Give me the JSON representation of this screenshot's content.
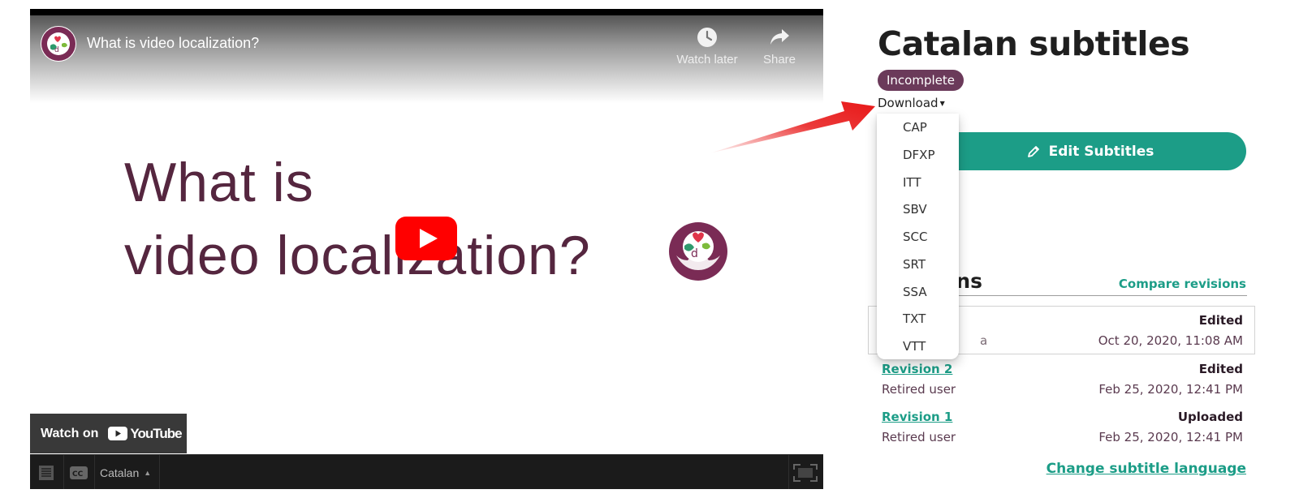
{
  "video": {
    "title": "What is video localization?",
    "watch_later_label": "Watch later",
    "share_label": "Share",
    "slide_line1": "What is",
    "slide_line2": "video localization?",
    "watch_on_label": "Watch on",
    "youtube_wordmark": "YouTube",
    "caption_language": "Catalan",
    "icons": {
      "channel_logo": "channel-logo-icon",
      "watch_later": "clock-icon",
      "share": "share-arrow-icon",
      "play": "play-icon",
      "transcript": "transcript-icon",
      "cc": "cc-icon",
      "caret_up": "caret-up-icon",
      "fullscreen": "fullscreen-icon"
    }
  },
  "panel": {
    "title": "Catalan subtitles",
    "status_badge": "Incomplete",
    "download_label": "Download",
    "download_menu": [
      "CAP",
      "DFXP",
      "ITT",
      "SBV",
      "SCC",
      "SRT",
      "SSA",
      "TXT",
      "VTT"
    ],
    "edit_button_label": "Edit Subtitles",
    "revisions_heading": "Revisions",
    "compare_revisions_label": "Compare revisions",
    "revisions": [
      {
        "label": "",
        "action": "Edited",
        "user": "a",
        "date": "Oct 20, 2020, 11:08 AM"
      },
      {
        "label": "Revision 2",
        "action": "Edited",
        "user": "Retired user",
        "date": "Feb 25, 2020, 12:41 PM"
      },
      {
        "label": "Revision 1",
        "action": "Uploaded",
        "user": "Retired user",
        "date": "Feb 25, 2020, 12:41 PM"
      }
    ],
    "change_language_label": "Change subtitle language"
  },
  "colors": {
    "accent_teal": "#1c9d87",
    "badge_plum": "#6b3a5a",
    "slide_text": "#55263f",
    "youtube_red": "#ff0000",
    "annotation_arrow": "#e81818"
  }
}
